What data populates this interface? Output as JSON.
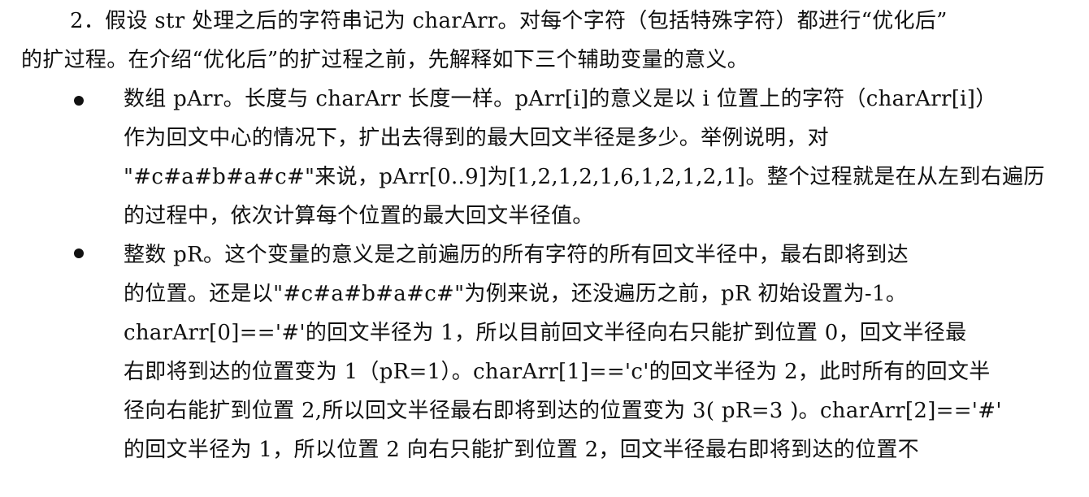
{
  "document": {
    "paragraph_2": {
      "line1": "2．假设 str 处理之后的字符串记为 charArr。对每个字符（包括特殊字符）都进行“优化后”",
      "line2": "的扩过程。在介绍“优化后”的扩过程之前，先解释如下三个辅助变量的意义。"
    },
    "bullets": [
      {
        "lines": [
          "数组 pArr。长度与 charArr 长度一样。pArr[i]的意义是以 i 位置上的字符（charArr[i]）",
          "作为回文中心的情况下，扩出去得到的最大回文半径是多少。举例说明，对",
          "\"#c#a#b#a#c#\"来说，pArr[0..9]为[1,2,1,2,1,6,1,2,1,2,1]。整个过程就是在从左到右遍历",
          "的过程中，依次计算每个位置的最大回文半径值。"
        ]
      },
      {
        "lines": [
          "整数 pR。这个变量的意义是之前遍历的所有字符的所有回文半径中，最右即将到达",
          "的位置。还是以\"#c#a#b#a#c#\"为例来说，还没遍历之前，pR 初始设置为-1。",
          "charArr[0]=='#'的回文半径为 1，所以目前回文半径向右只能扩到位置 0，回文半径最",
          "右即将到达的位置变为 1（pR=1）。charArr[1]=='c'的回文半径为 2，此时所有的回文半",
          "径向右能扩到位置 2,所以回文半径最右即将到达的位置变为 3( pR=3 )。charArr[2]=='#'",
          "的回文半径为 1，所以位置 2 向右只能扩到位置 2，回文半径最右即将到达的位置不"
        ]
      }
    ]
  }
}
